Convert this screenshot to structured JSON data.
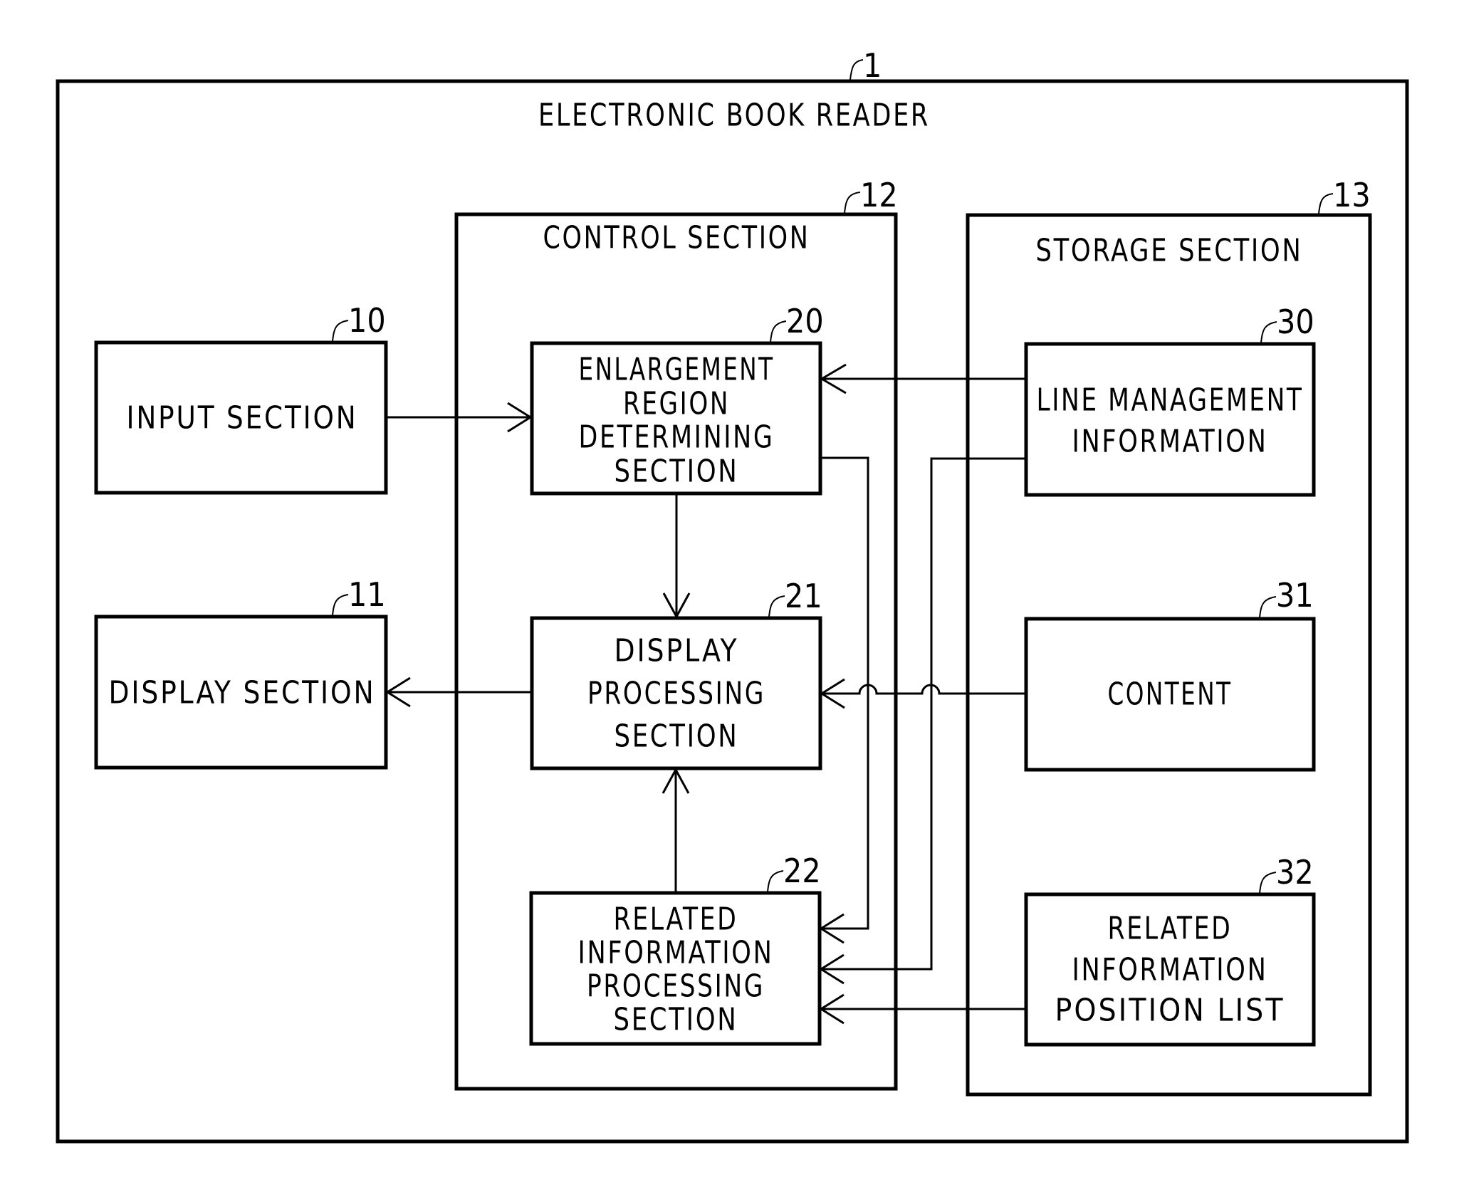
{
  "figure": {
    "title": "ELECTRONIC BOOK READER",
    "ref": "1"
  },
  "blocks": {
    "input": {
      "ref": "10",
      "lines": [
        "INPUT SECTION"
      ]
    },
    "display": {
      "ref": "11",
      "lines": [
        "DISPLAY SECTION"
      ]
    },
    "control": {
      "ref": "12",
      "title": "CONTROL SECTION"
    },
    "storage": {
      "ref": "13",
      "title": "STORAGE SECTION"
    },
    "enlargement": {
      "ref": "20",
      "lines": [
        "ENLARGEMENT",
        "REGION",
        "DETERMINING",
        "SECTION"
      ]
    },
    "display_processing": {
      "ref": "21",
      "lines": [
        "DISPLAY",
        "PROCESSING",
        "SECTION"
      ]
    },
    "related_processing": {
      "ref": "22",
      "lines": [
        "RELATED",
        "INFORMATION",
        "PROCESSING",
        "SECTION"
      ]
    },
    "line_management": {
      "ref": "30",
      "lines": [
        "LINE MANAGEMENT",
        "INFORMATION"
      ]
    },
    "content": {
      "ref": "31",
      "lines": [
        "CONTENT"
      ]
    },
    "position_list": {
      "ref": "32",
      "lines": [
        "RELATED",
        "INFORMATION",
        "POSITION LIST"
      ]
    }
  },
  "connections": [
    {
      "from": "INPUT SECTION",
      "to": "ENLARGEMENT REGION DETERMINING SECTION"
    },
    {
      "from": "LINE MANAGEMENT INFORMATION",
      "to": "ENLARGEMENT REGION DETERMINING SECTION"
    },
    {
      "from": "ENLARGEMENT REGION DETERMINING SECTION",
      "to": "DISPLAY PROCESSING SECTION"
    },
    {
      "from": "DISPLAY PROCESSING SECTION",
      "to": "DISPLAY SECTION"
    },
    {
      "from": "CONTENT",
      "to": "DISPLAY PROCESSING SECTION"
    },
    {
      "from": "RELATED INFORMATION PROCESSING SECTION",
      "to": "DISPLAY PROCESSING SECTION"
    },
    {
      "from": "ENLARGEMENT REGION DETERMINING SECTION",
      "to": "RELATED INFORMATION PROCESSING SECTION"
    },
    {
      "from": "LINE MANAGEMENT INFORMATION",
      "to": "RELATED INFORMATION PROCESSING SECTION"
    },
    {
      "from": "RELATED INFORMATION POSITION LIST",
      "to": "RELATED INFORMATION PROCESSING SECTION"
    }
  ]
}
